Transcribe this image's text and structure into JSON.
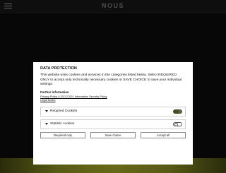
{
  "site": {
    "logo": "NOUS"
  },
  "dialog": {
    "title": "DATA PROTECTION",
    "body": "This website uses cookies and services in the categories listed below. Select REQUIRED ONLY to accept only technically necessary cookies or SAVE CHOICE to save your individual settings.",
    "further_heading": "Further information",
    "links": [
      "Privacy Policy & ISO 27001 Information Security Policy",
      "Legal Notice"
    ],
    "categories": [
      {
        "label": "Required Cookies",
        "enabled": true
      },
      {
        "label": "Statistic cookies",
        "enabled": false
      }
    ],
    "buttons": {
      "required_only": "Required only",
      "save_choice": "Save choice",
      "accept_all": "Accept all"
    }
  },
  "colors": {
    "page_bg": "#0b0b0b",
    "toggle_on": "#4a4a2a",
    "accent_yellow": "#8f9120"
  }
}
